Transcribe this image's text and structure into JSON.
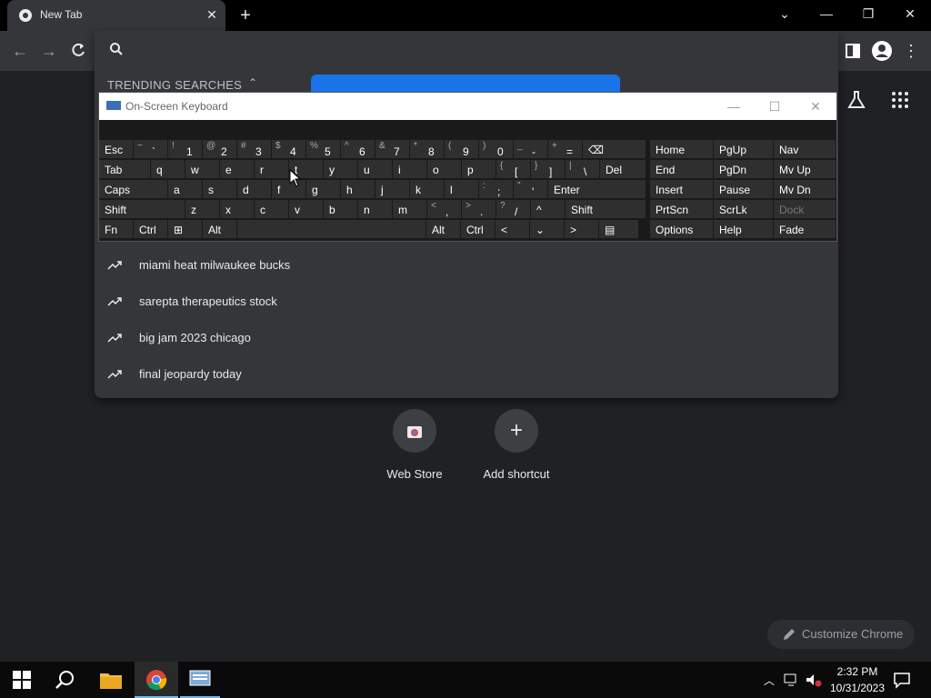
{
  "browser": {
    "tab_title": "New Tab",
    "new_tab_symbol": "+",
    "close_symbol": "✕",
    "window_controls": {
      "dropdown": "⌄",
      "minimize": "—",
      "restore": "❐",
      "close": "✕"
    }
  },
  "omnibox": {
    "value": "",
    "placeholder": "",
    "trending_header": "TRENDING SEARCHES",
    "suggestions": [
      "miami heat milwaukee bucks",
      "sarepta therapeutics stock",
      "big jam 2023 chicago",
      "final jeopardy today"
    ]
  },
  "osk": {
    "title": "On-Screen Keyboard",
    "controls": {
      "minimize": "—",
      "maximize": "☐",
      "close": "✕"
    },
    "row1": [
      {
        "k": "Esc"
      },
      {
        "s": "~",
        "k": "`"
      },
      {
        "s": "!",
        "k": "1"
      },
      {
        "s": "@",
        "k": "2"
      },
      {
        "s": "#",
        "k": "3"
      },
      {
        "s": "$",
        "k": "4"
      },
      {
        "s": "%",
        "k": "5"
      },
      {
        "s": "^",
        "k": "6"
      },
      {
        "s": "&",
        "k": "7"
      },
      {
        "s": "*",
        "k": "8"
      },
      {
        "s": "(",
        "k": "9"
      },
      {
        "s": ")",
        "k": "0"
      },
      {
        "s": "_",
        "k": "-"
      },
      {
        "s": "+",
        "k": "="
      },
      {
        "k": "⌫"
      }
    ],
    "row2": [
      {
        "k": "Tab"
      },
      {
        "k": "q"
      },
      {
        "k": "w"
      },
      {
        "k": "e"
      },
      {
        "k": "r"
      },
      {
        "k": "t"
      },
      {
        "k": "y"
      },
      {
        "k": "u"
      },
      {
        "k": "i"
      },
      {
        "k": "o"
      },
      {
        "k": "p"
      },
      {
        "s": "{",
        "k": "["
      },
      {
        "s": "}",
        "k": "]"
      },
      {
        "s": "|",
        "k": "\\"
      },
      {
        "k": "Del"
      }
    ],
    "row3": [
      {
        "k": "Caps"
      },
      {
        "k": "a"
      },
      {
        "k": "s"
      },
      {
        "k": "d"
      },
      {
        "k": "f"
      },
      {
        "k": "g"
      },
      {
        "k": "h"
      },
      {
        "k": "j"
      },
      {
        "k": "k"
      },
      {
        "k": "l"
      },
      {
        "s": ":",
        "k": ";"
      },
      {
        "s": "\"",
        "k": "'"
      },
      {
        "k": "Enter"
      }
    ],
    "row4": [
      {
        "k": "Shift"
      },
      {
        "k": "z"
      },
      {
        "k": "x"
      },
      {
        "k": "c"
      },
      {
        "k": "v"
      },
      {
        "k": "b"
      },
      {
        "k": "n"
      },
      {
        "k": "m"
      },
      {
        "s": "<",
        "k": ","
      },
      {
        "s": ">",
        "k": "."
      },
      {
        "s": "?",
        "k": "/"
      },
      {
        "k": "^"
      },
      {
        "k": "Shift"
      }
    ],
    "row5": [
      {
        "k": "Fn"
      },
      {
        "k": "Ctrl"
      },
      {
        "k": "⊞"
      },
      {
        "k": "Alt"
      },
      {
        "k": ""
      },
      {
        "k": "Alt"
      },
      {
        "k": "Ctrl"
      },
      {
        "k": "<"
      },
      {
        "k": "⌄"
      },
      {
        "k": ">"
      },
      {
        "k": "▤"
      }
    ],
    "side": [
      [
        "Home",
        "PgUp",
        "Nav"
      ],
      [
        "End",
        "PgDn",
        "Mv Up"
      ],
      [
        "Insert",
        "Pause",
        "Mv Dn"
      ],
      [
        "PrtScn",
        "ScrLk",
        "Dock"
      ],
      [
        "Options",
        "Help",
        "Fade"
      ]
    ]
  },
  "ntp": {
    "shortcuts": [
      {
        "label": "Web Store"
      },
      {
        "label": "Add shortcut",
        "symbol": "+"
      }
    ],
    "customize_label": "Customize Chrome"
  },
  "taskbar": {
    "time": "2:32 PM",
    "date": "10/31/2023"
  }
}
